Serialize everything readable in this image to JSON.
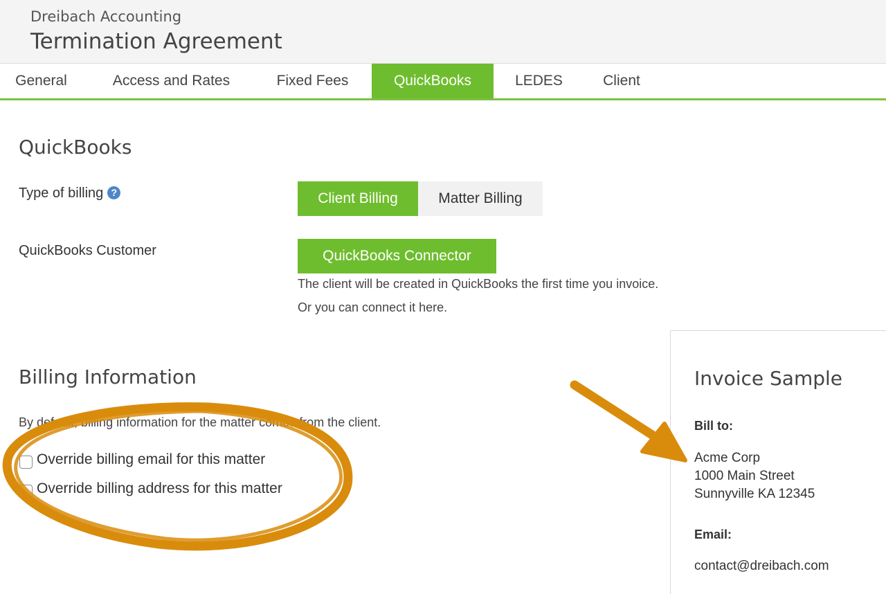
{
  "header": {
    "org": "Dreibach Accounting",
    "title": "Termination Agreement"
  },
  "tabs": [
    {
      "label": "General"
    },
    {
      "label": "Access and Rates"
    },
    {
      "label": "Fixed Fees"
    },
    {
      "label": "QuickBooks",
      "active": true
    },
    {
      "label": "LEDES"
    },
    {
      "label": "Client"
    }
  ],
  "quickbooks": {
    "title": "QuickBooks",
    "billing_type_label": "Type of billing",
    "billing_options": [
      "Client Billing",
      "Matter Billing"
    ],
    "selected_billing": "Client Billing",
    "customer_label": "QuickBooks Customer",
    "connector_button": "QuickBooks Connector",
    "hint_line1": "The client will be created in QuickBooks the first time you invoice.",
    "hint_line2": "Or you can connect it here."
  },
  "billing_info": {
    "title": "Billing Information",
    "description": "By default, billing information for the matter comes from the client.",
    "options": [
      {
        "label": "Override billing email for this matter",
        "checked": false
      },
      {
        "label": "Override billing address for this matter",
        "checked": false
      }
    ]
  },
  "invoice_sample": {
    "title": "Invoice Sample",
    "bill_to_label": "Bill to:",
    "address_lines": [
      "Acme Corp",
      "1000 Main Street",
      "Sunnyville KA 12345"
    ],
    "email_label": "Email:",
    "email": "contact@dreibach.com"
  },
  "colors": {
    "accent_green": "#6ebd2e",
    "annotation_orange": "#d98c0c",
    "help_blue": "#4f86c6"
  }
}
